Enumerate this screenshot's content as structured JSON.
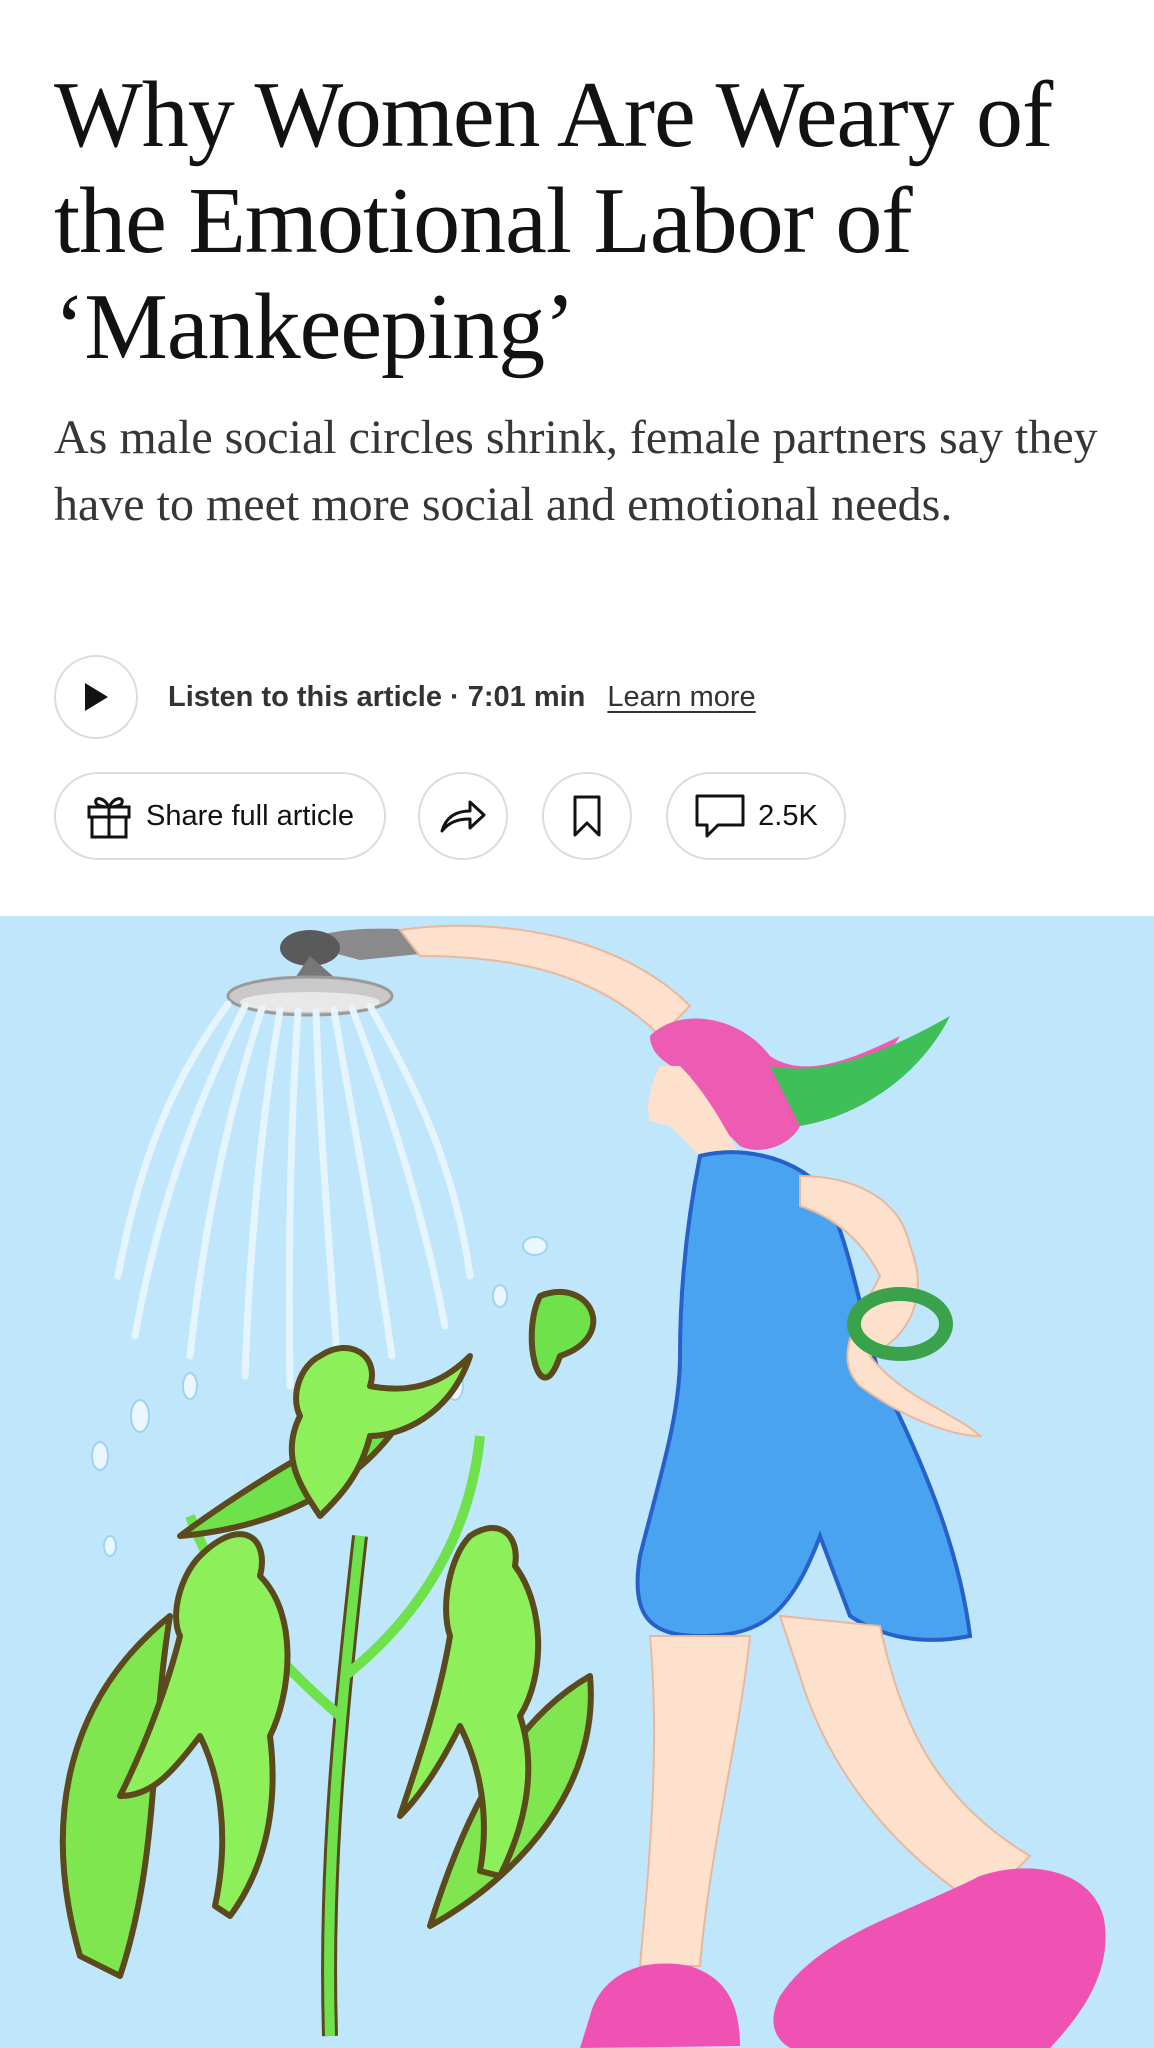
{
  "article": {
    "headline": "Why Women Are Weary of the Emotional Labor of ‘Mankeeping’",
    "summary": "As male social circles shrink, female partners say they have to meet more social and emotional needs."
  },
  "audio": {
    "label": "Listen to this article · 7:01 min",
    "learn_more": "Learn more"
  },
  "toolbar": {
    "share_full_label": "Share full article",
    "comments_count": "2.5K"
  },
  "icons": {
    "play": "play-icon",
    "gift": "gift-icon",
    "share": "share-arrow-icon",
    "bookmark": "bookmark-icon",
    "comment": "comment-bubble-icon"
  },
  "colors": {
    "sky": "#bfe6fb",
    "dress": "#4aa3f0",
    "hair_pink": "#ee5bb2",
    "hair_green": "#3fbf57",
    "plant_green": "#6fe14a",
    "shoes": "#f052b4"
  }
}
